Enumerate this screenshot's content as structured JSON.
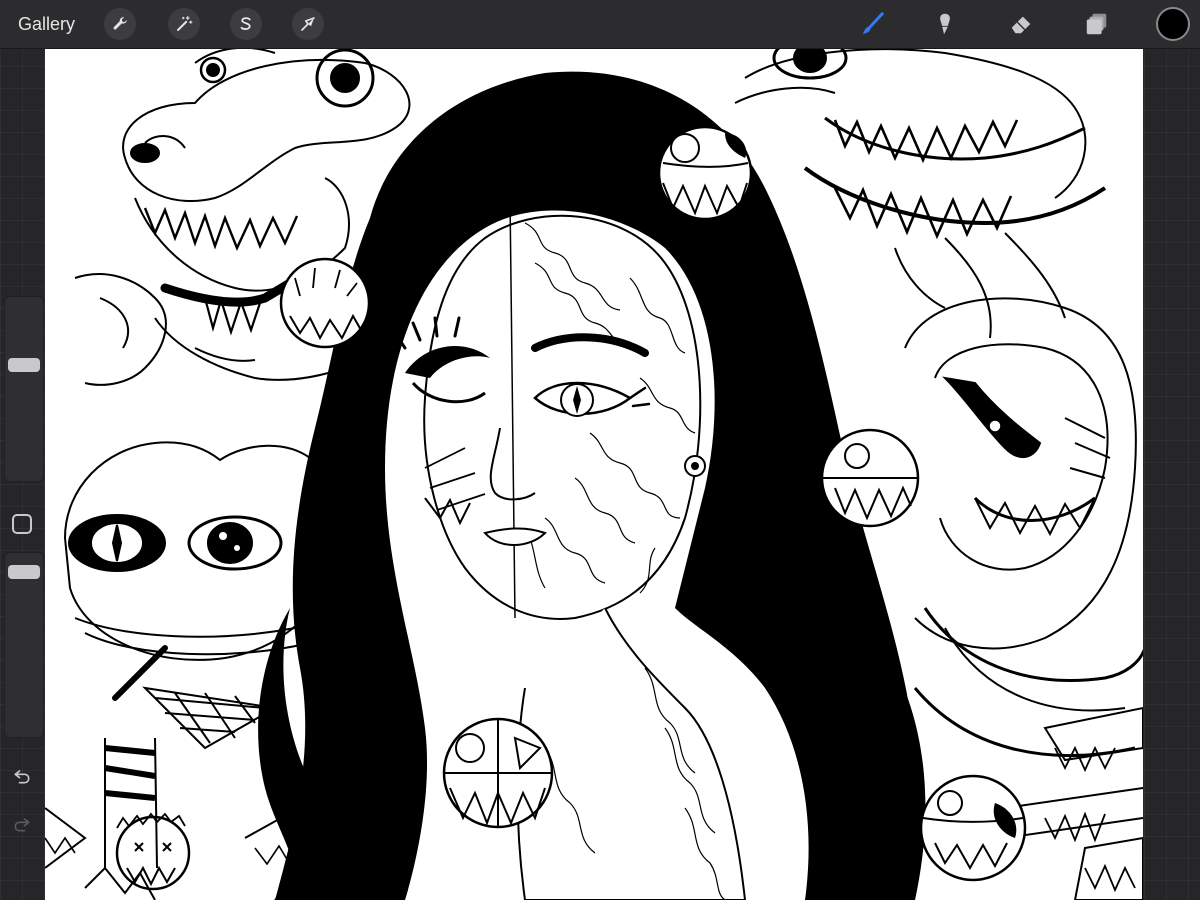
{
  "app": {
    "gallery_label": "Gallery"
  },
  "toolbar": {
    "left_tools": [
      {
        "name": "actions",
        "icon": "wrench-icon"
      },
      {
        "name": "adjustments",
        "icon": "magic-wand-icon"
      },
      {
        "name": "selection",
        "icon": "selection-s-icon"
      },
      {
        "name": "transform",
        "icon": "arrow-cursor-icon"
      }
    ],
    "right_tools": [
      {
        "name": "brush",
        "icon": "brush-icon",
        "active": true
      },
      {
        "name": "smudge",
        "icon": "smudge-icon",
        "active": false
      },
      {
        "name": "eraser",
        "icon": "eraser-icon",
        "active": false
      },
      {
        "name": "layers",
        "icon": "layers-icon",
        "active": false
      }
    ],
    "current_color": "#000000"
  },
  "sidebar": {
    "brush_size_level": 0.35,
    "opacity_level": 0.05,
    "undo_icon": "undo-icon",
    "redo_icon": "redo-icon"
  },
  "colors": {
    "toolbar_bg": "#2c2c2e",
    "accent_blue": "#2f7cf6",
    "icon_grey": "#c9c9cc",
    "canvas_bg": "#ffffff",
    "ink": "#000000"
  }
}
